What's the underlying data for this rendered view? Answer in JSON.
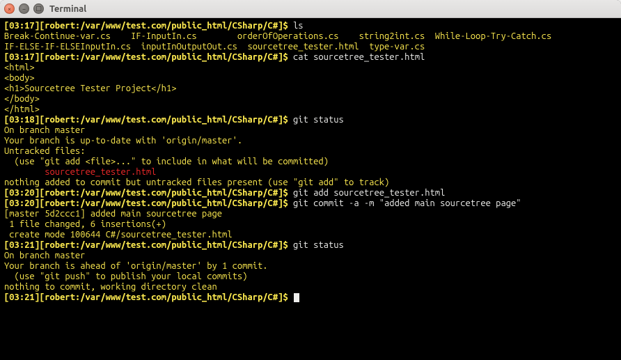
{
  "window": {
    "title": "Terminal"
  },
  "lines": [
    {
      "segs": [
        {
          "c": "yellow-bold",
          "t": "[03:17][robert:/var/www/test.com/public_html/CSharp/C#]$ "
        },
        {
          "c": "white",
          "t": "ls"
        }
      ]
    },
    {
      "segs": [
        {
          "c": "yellow",
          "t": "Break-Continue-var.cs    IF-InputIn.cs        orderOfOperations.cs    string2int.cs  While-Loop-Try-Catch.cs"
        }
      ]
    },
    {
      "segs": [
        {
          "c": "yellow",
          "t": "IF-ELSE-IF-ELSEInputIn.cs  inputInOutputOut.cs  sourcetree_tester.html  type-var.cs"
        }
      ]
    },
    {
      "segs": [
        {
          "c": "yellow-bold",
          "t": "[03:17][robert:/var/www/test.com/public_html/CSharp/C#]$ "
        },
        {
          "c": "white",
          "t": "cat sourcetree_tester.html"
        }
      ]
    },
    {
      "segs": [
        {
          "c": "yellow",
          "t": ""
        }
      ]
    },
    {
      "segs": [
        {
          "c": "yellow",
          "t": "<html>"
        }
      ]
    },
    {
      "segs": [
        {
          "c": "yellow",
          "t": "<body>"
        }
      ]
    },
    {
      "segs": [
        {
          "c": "yellow",
          "t": "<h1>Sourcetree Tester Project</h1>"
        }
      ]
    },
    {
      "segs": [
        {
          "c": "yellow",
          "t": "</body>"
        }
      ]
    },
    {
      "segs": [
        {
          "c": "yellow",
          "t": "</html>"
        }
      ]
    },
    {
      "segs": [
        {
          "c": "yellow-bold",
          "t": "[03:18][robert:/var/www/test.com/public_html/CSharp/C#]$ "
        },
        {
          "c": "white",
          "t": "git status"
        }
      ]
    },
    {
      "segs": [
        {
          "c": "yellow",
          "t": "On branch master"
        }
      ]
    },
    {
      "segs": [
        {
          "c": "yellow",
          "t": "Your branch is up-to-date with 'origin/master'."
        }
      ]
    },
    {
      "segs": [
        {
          "c": "yellow",
          "t": "Untracked files:"
        }
      ]
    },
    {
      "segs": [
        {
          "c": "yellow",
          "t": "  (use \"git add <file>...\" to include in what will be committed)"
        }
      ]
    },
    {
      "segs": [
        {
          "c": "yellow",
          "t": ""
        }
      ]
    },
    {
      "segs": [
        {
          "c": "red",
          "t": "\tsourcetree_tester.html"
        }
      ]
    },
    {
      "segs": [
        {
          "c": "yellow",
          "t": ""
        }
      ]
    },
    {
      "segs": [
        {
          "c": "yellow",
          "t": "nothing added to commit but untracked files present (use \"git add\" to track)"
        }
      ]
    },
    {
      "segs": [
        {
          "c": "yellow-bold",
          "t": "[03:20][robert:/var/www/test.com/public_html/CSharp/C#]$ "
        },
        {
          "c": "white",
          "t": "git add sourcetree_tester.html"
        }
      ]
    },
    {
      "segs": [
        {
          "c": "yellow-bold",
          "t": "[03:20][robert:/var/www/test.com/public_html/CSharp/C#]$ "
        },
        {
          "c": "white",
          "t": "git commit -a -m \"added main sourcetree page\""
        }
      ]
    },
    {
      "segs": [
        {
          "c": "yellow",
          "t": "[master 5d2ccc1] added main sourcetree page"
        }
      ]
    },
    {
      "segs": [
        {
          "c": "yellow",
          "t": " 1 file changed, 6 insertions(+)"
        }
      ]
    },
    {
      "segs": [
        {
          "c": "yellow",
          "t": " create mode 100644 C#/sourcetree_tester.html"
        }
      ]
    },
    {
      "segs": [
        {
          "c": "yellow-bold",
          "t": "[03:21][robert:/var/www/test.com/public_html/CSharp/C#]$ "
        },
        {
          "c": "white",
          "t": "git status"
        }
      ]
    },
    {
      "segs": [
        {
          "c": "yellow",
          "t": "On branch master"
        }
      ]
    },
    {
      "segs": [
        {
          "c": "yellow",
          "t": "Your branch is ahead of 'origin/master' by 1 commit."
        }
      ]
    },
    {
      "segs": [
        {
          "c": "yellow",
          "t": "  (use \"git push\" to publish your local commits)"
        }
      ]
    },
    {
      "segs": [
        {
          "c": "yellow",
          "t": "nothing to commit, working directory clean"
        }
      ]
    },
    {
      "segs": [
        {
          "c": "yellow-bold",
          "t": "[03:21][robert:/var/www/test.com/public_html/CSharp/C#]$ "
        }
      ],
      "cursor": true
    }
  ]
}
